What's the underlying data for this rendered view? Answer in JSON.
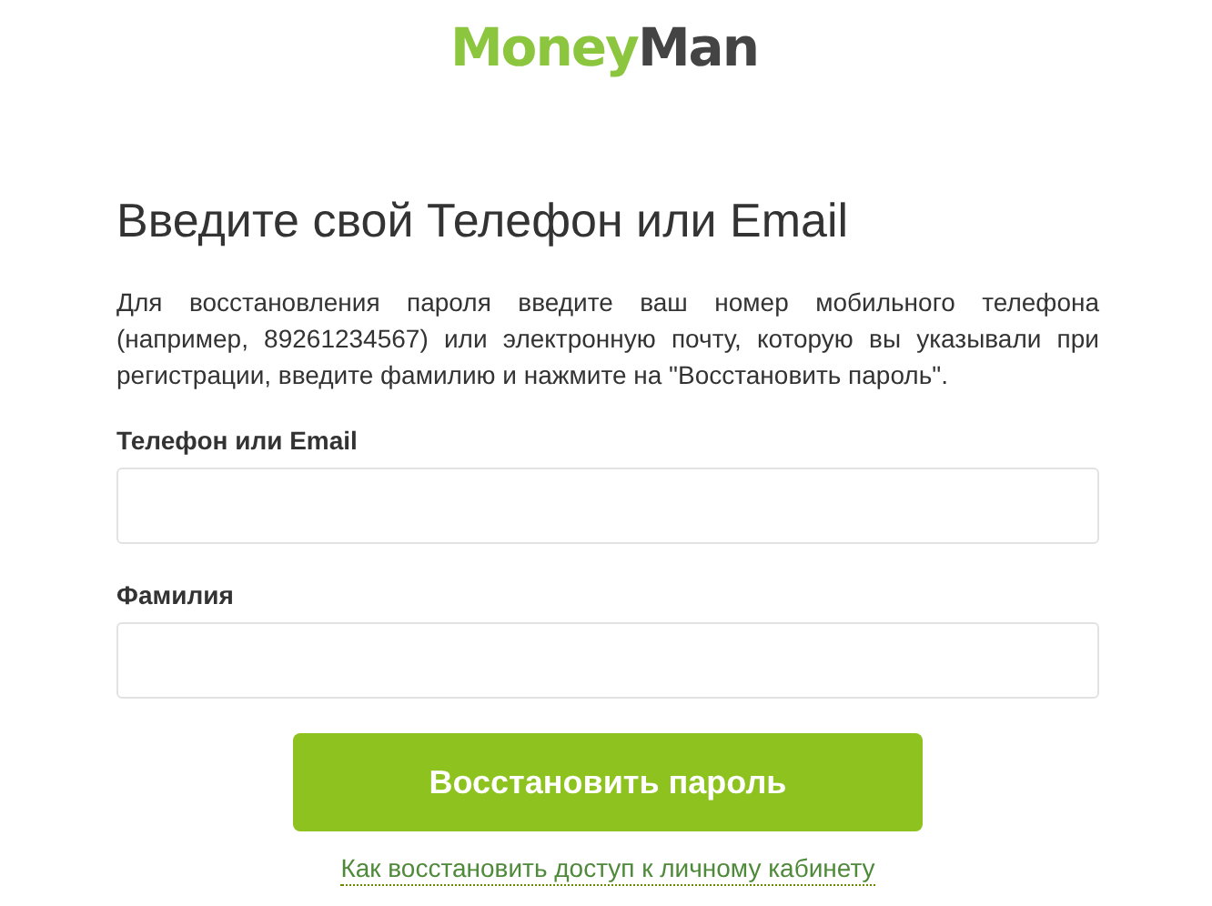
{
  "logo": {
    "part1": "Money",
    "part2": "Man"
  },
  "heading": "Введите свой Телефон или Email",
  "description": "Для восстановления пароля введите ваш номер мобильного телефона (например, 89261234567) или электронную почту, которую вы указывали при регистрации, введите фамилию и нажмите на \"Восстановить пароль\".",
  "fields": [
    {
      "label": "Телефон или Email"
    },
    {
      "label": "Фамилия"
    }
  ],
  "submit_button": "Восстановить пароль",
  "help_link": "Как восстановить доступ к личному кабинету"
}
